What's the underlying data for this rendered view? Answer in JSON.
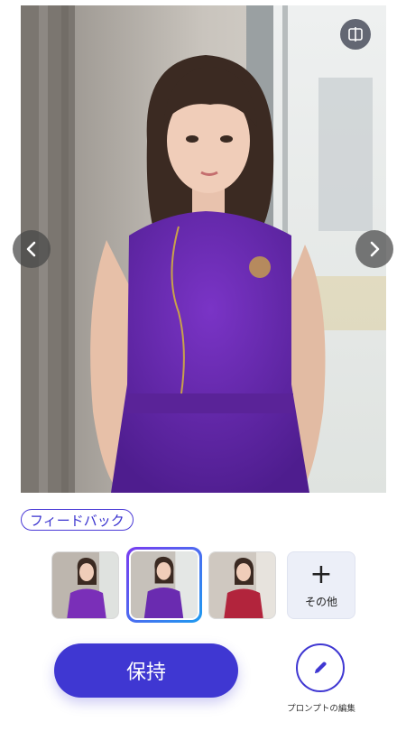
{
  "feedback": {
    "label": "フィードバック"
  },
  "more": {
    "label": "その他",
    "plus": "+"
  },
  "actions": {
    "keep_label": "保持",
    "edit_prompt_label": "プロンプトの編集"
  },
  "icons": {
    "compare": "compare-icon",
    "prev": "chevron-left-icon",
    "next": "chevron-right-icon",
    "pen": "pen-icon"
  },
  "thumbnails": [
    {
      "name": "variant-1",
      "dress": "purple",
      "selected": false
    },
    {
      "name": "variant-2",
      "dress": "purple",
      "selected": true
    },
    {
      "name": "variant-3",
      "dress": "red",
      "selected": false
    }
  ],
  "colors": {
    "accent": "#3f37d2",
    "selected_gradient_start": "#7a3bf0",
    "selected_gradient_end": "#1d9bf0",
    "dress_purple": "#6a2bb0",
    "dress_red": "#b2243c"
  }
}
